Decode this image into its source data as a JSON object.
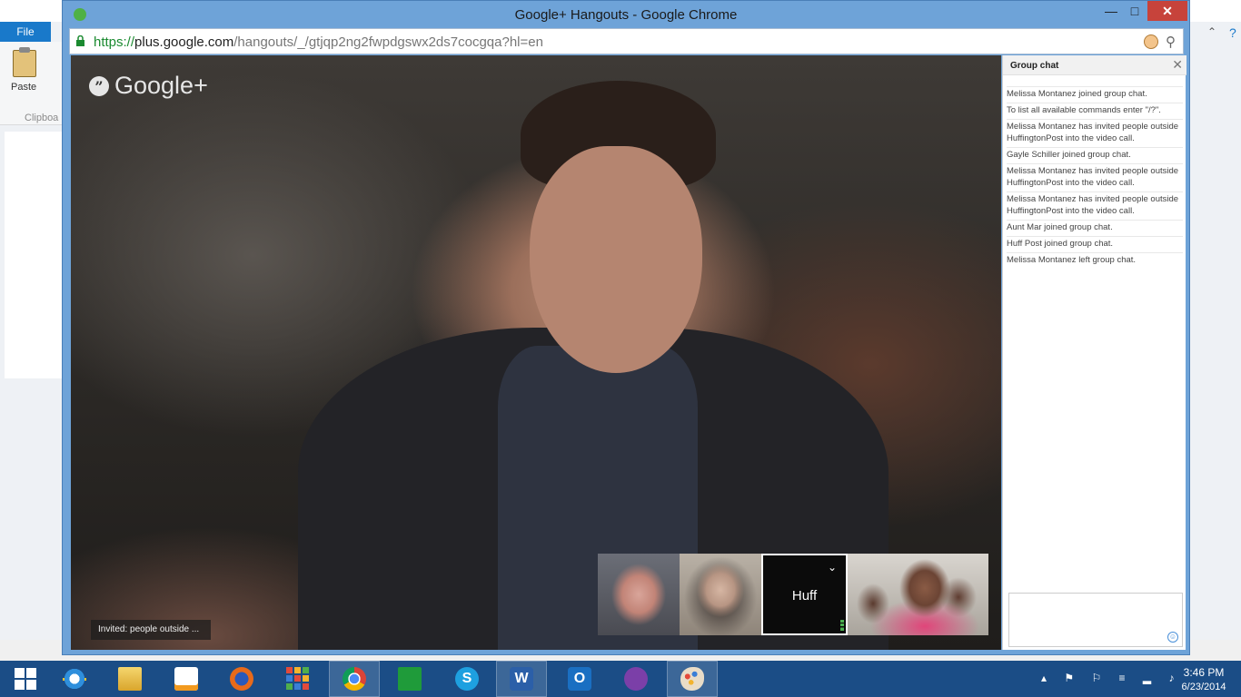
{
  "paint": {
    "file_tab": "File",
    "paste_label": "Paste",
    "clipboard_label": "Clipboa",
    "help_icon": "help-icon"
  },
  "window": {
    "title": "Google+ Hangouts - Google Chrome",
    "minimize": "—",
    "maximize": "□",
    "close": "✕"
  },
  "address": {
    "scheme": "https://",
    "host": "plus.google.com",
    "path": "/hangouts/_/gtjqp2ng2fwpdgswx2ds7cocgqa?hl=en"
  },
  "video": {
    "logo_text": "Google+",
    "quote_glyph": "”",
    "invited_text": "Invited: people outside ..."
  },
  "filmstrip": {
    "participant_3_label": "Huff",
    "participant_3_chevron": "⌄"
  },
  "chat": {
    "title": "Group chat",
    "close": "✕",
    "messages": [
      "Melissa Montanez joined group chat.",
      "To list all available commands enter \"/?\".",
      "Melissa Montanez has invited people outside HuffingtonPost into the video call.",
      "Gayle Schiller joined group chat.",
      "Melissa Montanez has invited people outside HuffingtonPost into the video call.",
      "Melissa Montanez has invited people outside HuffingtonPost into the video call.",
      "Aunt Mar joined group chat.",
      "Huff Post joined group chat.",
      "Melissa Montanez left group chat."
    ],
    "emoji": "☺"
  },
  "taskbar": {
    "time": "3:46 PM",
    "date": "6/23/2014",
    "tray_icons": "▴ ⚑ ⚐ ≡ ▂ ♪"
  },
  "colors": {
    "chrome_frame": "#6ea3d8",
    "taskbar": "#1b4d86",
    "close_red": "#c7433b",
    "url_green": "#1b8a30"
  }
}
